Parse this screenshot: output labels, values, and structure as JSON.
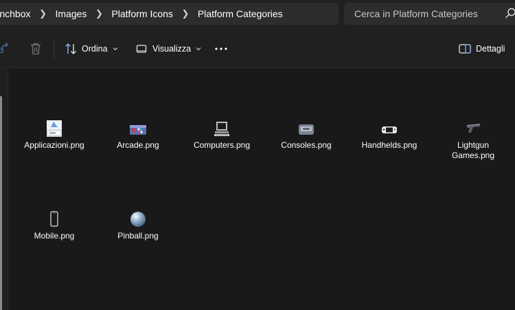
{
  "breadcrumb": {
    "items": [
      "Launchbox",
      "Images",
      "Platform Icons",
      "Platform Categories"
    ]
  },
  "search": {
    "placeholder": "Cerca in Platform Categories"
  },
  "toolbar": {
    "sort_label": "Ordina",
    "view_label": "Visualizza",
    "details_label": "Dettagli"
  },
  "files": [
    {
      "name": "Applicazioni.png",
      "icon": "setup-box-icon"
    },
    {
      "name": "Arcade.png",
      "icon": "arcade-controls-icon"
    },
    {
      "name": "Computers.png",
      "icon": "computer-icon"
    },
    {
      "name": "Consoles.png",
      "icon": "console-icon"
    },
    {
      "name": "Handhelds.png",
      "icon": "handheld-icon"
    },
    {
      "name": "Lightgun Games.png",
      "icon": "lightgun-icon"
    },
    {
      "name": "Mobile.png",
      "icon": "mobile-phone-icon"
    },
    {
      "name": "Pinball.png",
      "icon": "pinball-icon"
    }
  ],
  "colors": {
    "background": "#191919",
    "panel": "#202020",
    "field": "#2d2d2d",
    "accent": "#8ab4f8"
  }
}
